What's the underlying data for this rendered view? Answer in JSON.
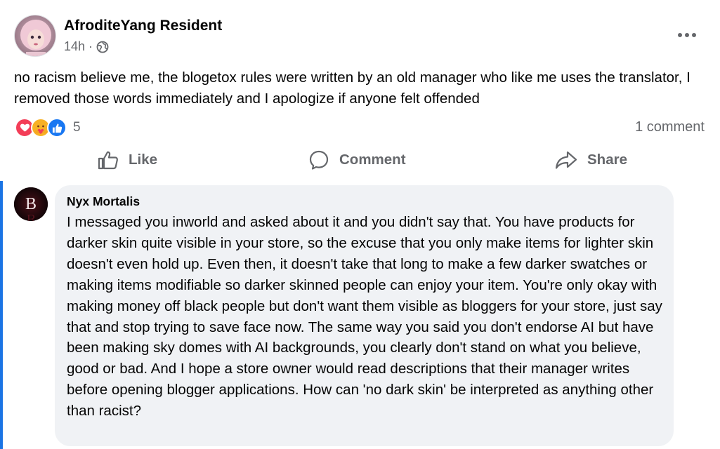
{
  "post": {
    "author": "AfroditeYang Resident",
    "time": "14h",
    "audience_icon": "globe-icon",
    "text": "no racism believe me, the blogetox rules were written by an old manager who like me uses the translator, I removed those words immediately and I apologize if anyone felt offended",
    "reactions": {
      "icons": [
        "love-icon",
        "care-icon",
        "like-icon"
      ],
      "count": "5"
    },
    "comment_count": "1 comment"
  },
  "actions": {
    "like": "Like",
    "comment": "Comment",
    "share": "Share"
  },
  "comment": {
    "author": "Nyx Mortalis",
    "avatar_letter": "B",
    "text": "I messaged you inworld and asked about it and you didn't say that. You have products for darker skin quite visible in your store, so the excuse that you only make items for lighter skin doesn't even hold up. Even then, it doesn't take that long to make a few darker swatches or making items modifiable so darker skinned people can enjoy your item. You're only okay with making money off black people but don't want them visible as bloggers for your store, just say that and stop trying to save face now. The same way you said you don't endorse AI but have been making sky domes with AI backgrounds, you clearly don't stand on what you believe, good or bad. And I hope a store owner would read descriptions that their manager writes before opening blogger applications. How can 'no dark skin' be interpreted as anything other than racist?"
  },
  "colors": {
    "accent": "#1b74e4",
    "secondary_text": "#65676b",
    "love": "#f33e58",
    "care": "#f7b125",
    "like": "#1877f2"
  }
}
